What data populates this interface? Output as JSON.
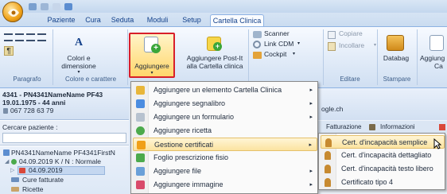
{
  "tabs": [
    "Paziente",
    "Cura",
    "Seduta",
    "Moduli",
    "Setup",
    "Cartella Clinica"
  ],
  "ribbon": {
    "groups": [
      "Paragrafo",
      "Colore e carattere",
      "Editare",
      "Stampare"
    ],
    "colori_label_1": "Colori e",
    "colori_label_2": "dimensione",
    "aggiungere_label": "Aggiungere",
    "postit_label_1": "Aggiungere Post-It",
    "postit_label_2": "alla Cartella clinica",
    "scanner_label": "Scanner",
    "link_cdm_label": "Link CDM",
    "cockpit_label": "Cockpit",
    "copiare_label": "Copiare",
    "incollare_label": "Incollare",
    "databag_label": "Databag",
    "aggiung_cut_label": "Aggiung",
    "ca_cut_label": "Ca"
  },
  "patient": {
    "header": "4341 - PN4341NameName PF43",
    "dob": "19.01.1975 - 44 anni",
    "phone": "067 728 63 79",
    "search_label": "Cercare paziente :"
  },
  "tree": {
    "patient_node": "PN4341NameName PF4341FirstN",
    "date_node": "04.09.2019 K / N : Normale",
    "sub_date": "04.09.2019",
    "cure": "Cure fatturate",
    "ricette": "Ricette"
  },
  "right_panel": {
    "email_cut": "ogle.ch",
    "tab1": "Fatturazione",
    "tab2": "Informazioni"
  },
  "menu": [
    {
      "label": "Aggiungere un elemento Cartella Clinica",
      "arrow": "▸"
    },
    {
      "label": "Aggiungere segnalibro",
      "arrow": "▸"
    },
    {
      "label": "Aggiungere un formulario",
      "arrow": "▸"
    },
    {
      "label": "Aggiungere ricetta",
      "arrow": ""
    },
    {
      "label": "Gestione certificati",
      "arrow": "▸"
    },
    {
      "label": "Foglio prescrizione fisio",
      "arrow": ""
    },
    {
      "label": "Aggiungere file",
      "arrow": "▸"
    },
    {
      "label": "Aggiungere immagine",
      "arrow": "▸"
    }
  ],
  "submenu": [
    {
      "label": "Cert. d'incapacità semplice"
    },
    {
      "label": "Cert. d'incapacità dettagliato"
    },
    {
      "label": "Cert. d'incapacità testo libero"
    },
    {
      "label": "Certificato tipo 4"
    }
  ],
  "colors": {
    "highlight_border": "#d81f2a",
    "accent": "#15428b"
  }
}
